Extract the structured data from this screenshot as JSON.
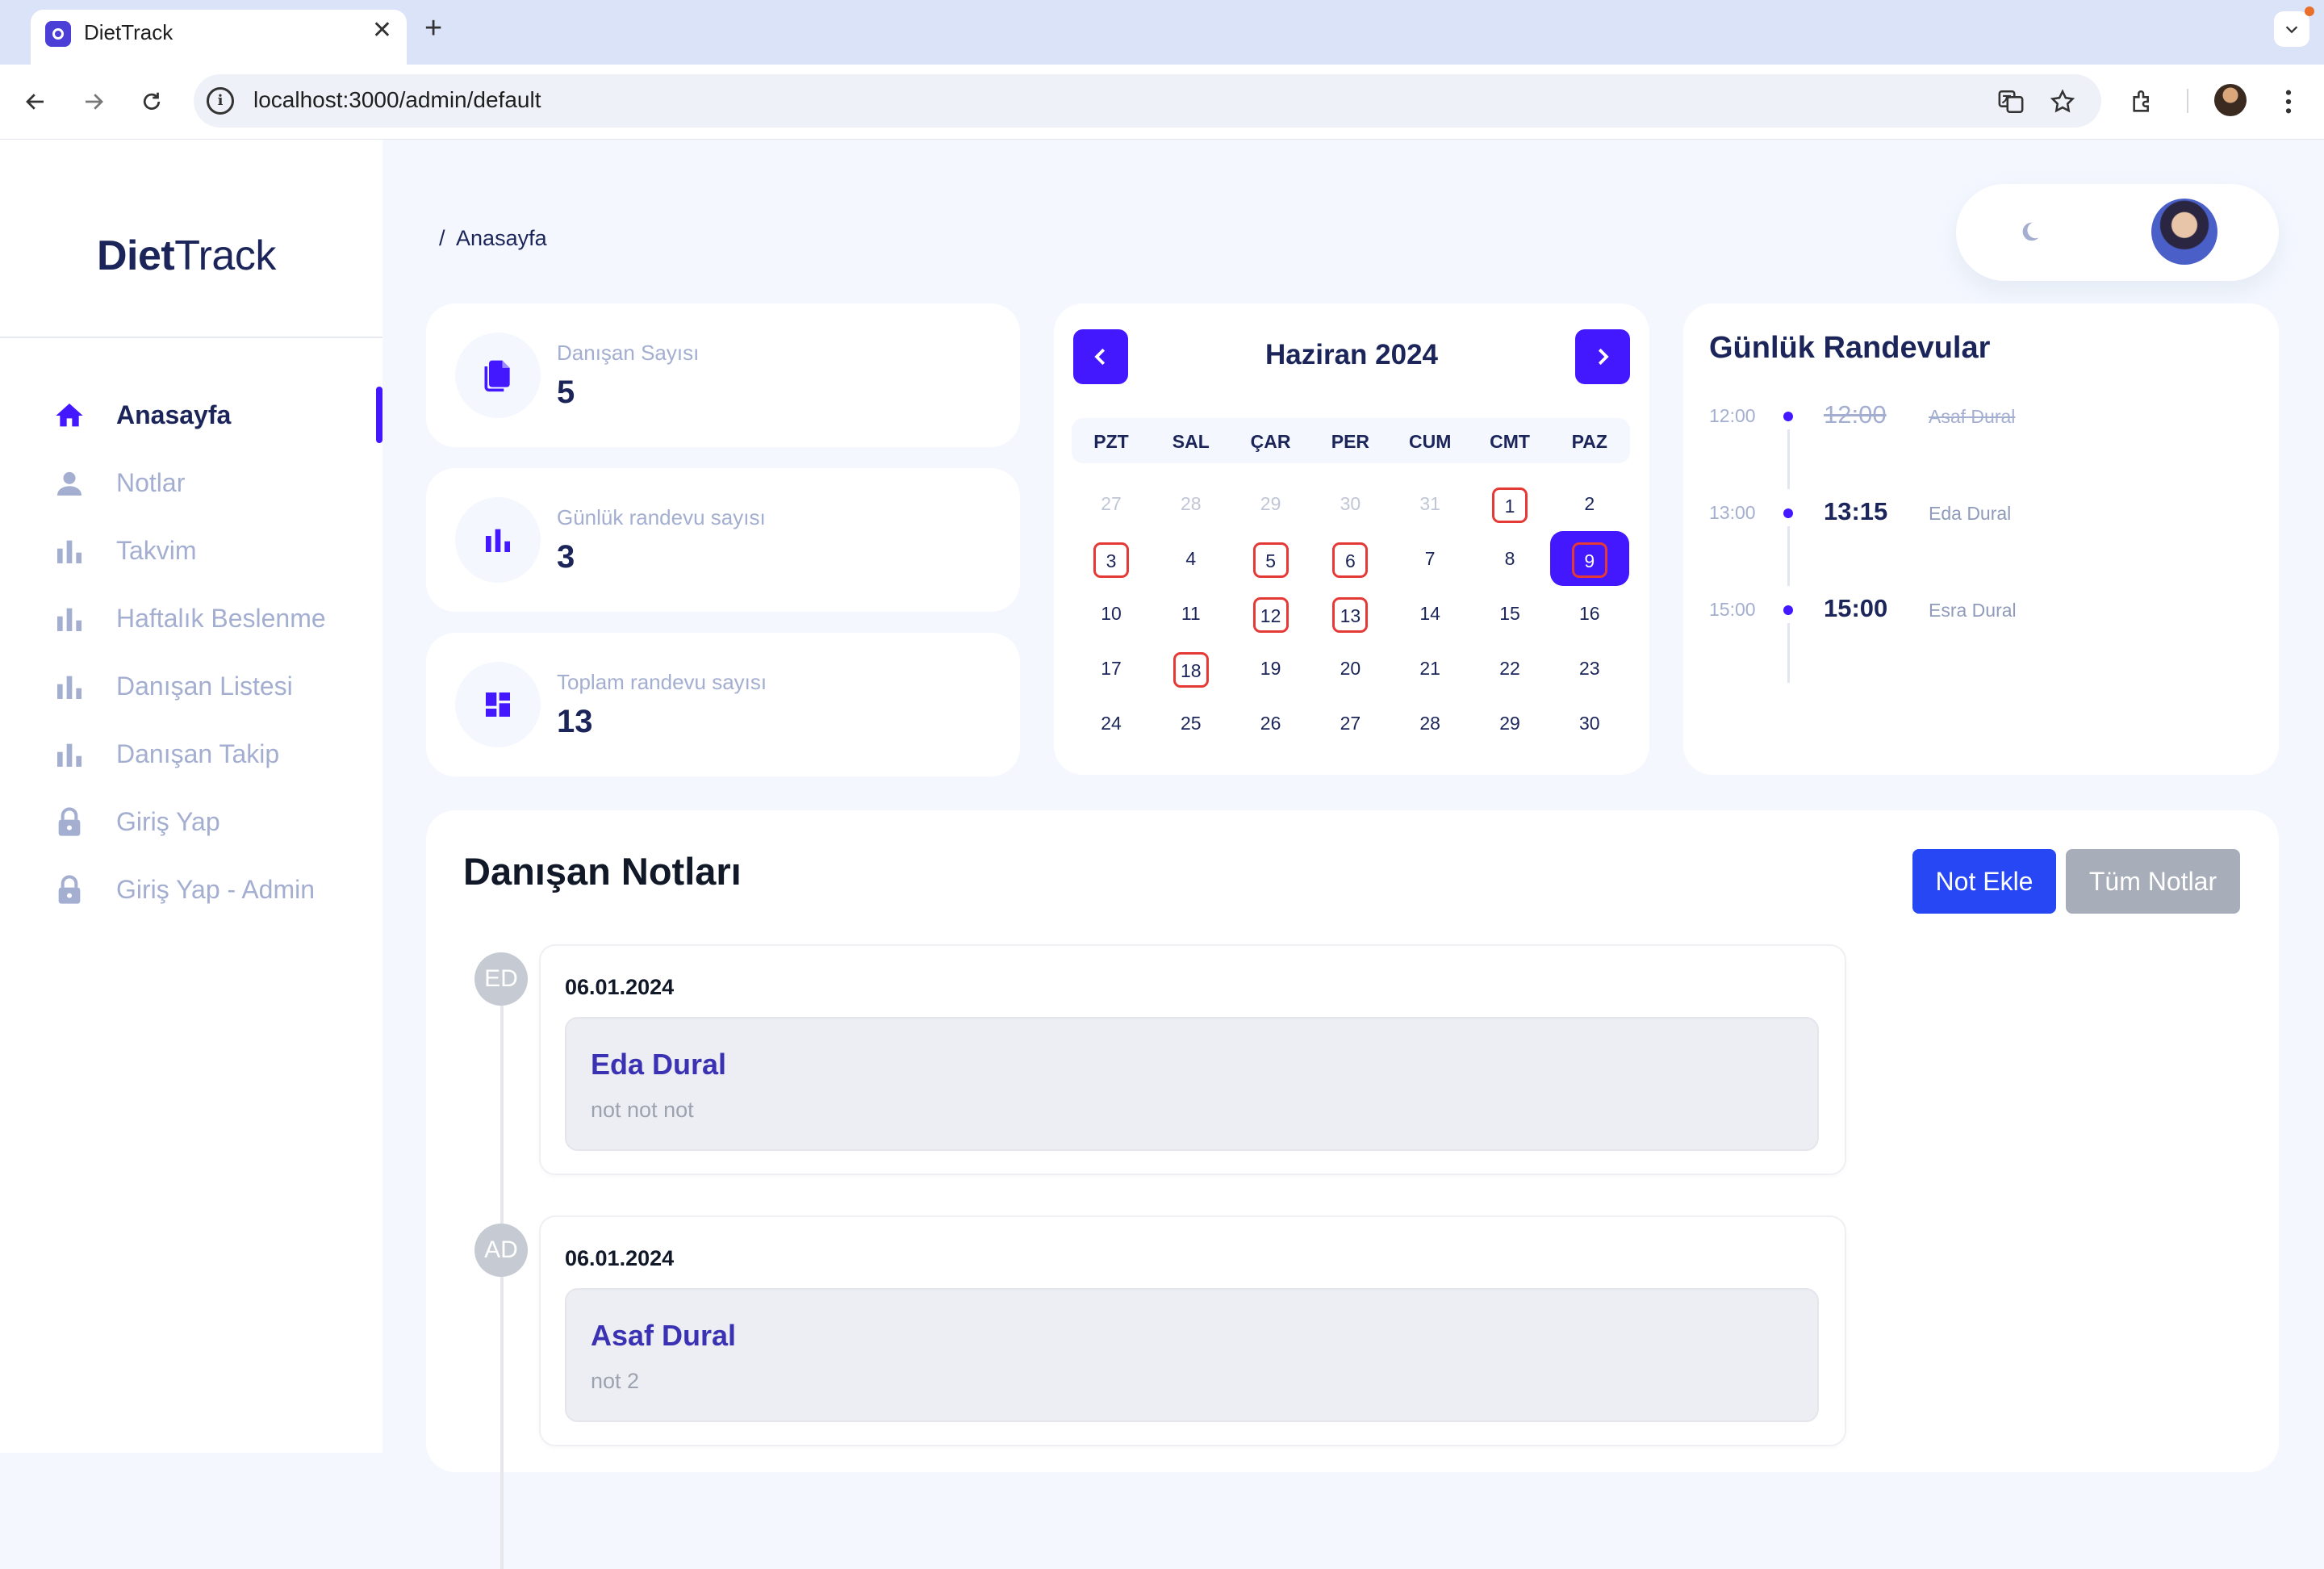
{
  "browser": {
    "tab_title": "DietTrack",
    "url": "localhost:3000/admin/default"
  },
  "sidebar": {
    "logo_bold": "Diet",
    "logo_light": "Track",
    "items": [
      {
        "label": "Anasayfa",
        "icon": "home-icon",
        "active": true
      },
      {
        "label": "Notlar",
        "icon": "person-icon"
      },
      {
        "label": "Takvim",
        "icon": "bar-chart-icon"
      },
      {
        "label": "Haftalık Beslenme",
        "icon": "bar-chart-icon"
      },
      {
        "label": "Danışan Listesi",
        "icon": "bar-chart-icon"
      },
      {
        "label": "Danışan Takip",
        "icon": "bar-chart-icon"
      },
      {
        "label": "Giriş Yap",
        "icon": "lock-icon"
      },
      {
        "label": "Giriş Yap - Admin",
        "icon": "lock-icon"
      }
    ]
  },
  "header": {
    "breadcrumb_sep": "/",
    "breadcrumb": "Anasayfa"
  },
  "stats": [
    {
      "label": "Danışan Sayısı",
      "value": "5",
      "icon": "files-icon"
    },
    {
      "label": "Günlük randevu sayısı",
      "value": "3",
      "icon": "bar-chart-icon"
    },
    {
      "label": "Toplam randevu sayısı",
      "value": "13",
      "icon": "dashboard-icon"
    }
  ],
  "calendar": {
    "title": "Haziran 2024",
    "weekdays": [
      "PZT",
      "SAL",
      "ÇAR",
      "PER",
      "CUM",
      "CMT",
      "PAZ"
    ],
    "weeks": [
      [
        "27",
        "28",
        "29",
        "30",
        "31",
        "1",
        "2"
      ],
      [
        "3",
        "4",
        "5",
        "6",
        "7",
        "8",
        "9"
      ],
      [
        "10",
        "11",
        "12",
        "13",
        "14",
        "15",
        "16"
      ],
      [
        "17",
        "18",
        "19",
        "20",
        "21",
        "22",
        "23"
      ],
      [
        "24",
        "25",
        "26",
        "27",
        "28",
        "29",
        "30"
      ]
    ],
    "muted_days_first_week": 5,
    "marked_days": [
      "1",
      "3",
      "5",
      "6",
      "9",
      "12",
      "13",
      "18"
    ],
    "selected_day": "9",
    "accent": "#4318ff",
    "mark_color": "#e53935"
  },
  "appointments": {
    "title": "Günlük Randevular",
    "items": [
      {
        "slot": "12:00",
        "time": "12:00",
        "name": "Asaf Dural",
        "cancelled": true
      },
      {
        "slot": "13:00",
        "time": "13:15",
        "name": "Eda Dural",
        "cancelled": false
      },
      {
        "slot": "15:00",
        "time": "15:00",
        "name": "Esra Dural",
        "cancelled": false
      }
    ]
  },
  "notes": {
    "title": "Danışan Notları",
    "add_label": "Not Ekle",
    "all_label": "Tüm Notlar",
    "items": [
      {
        "initials": "ED",
        "date": "06.01.2024",
        "name": "Eda Dural",
        "text": "not not not"
      },
      {
        "initials": "AD",
        "date": "06.01.2024",
        "name": "Asaf Dural",
        "text": "not 2"
      }
    ]
  }
}
